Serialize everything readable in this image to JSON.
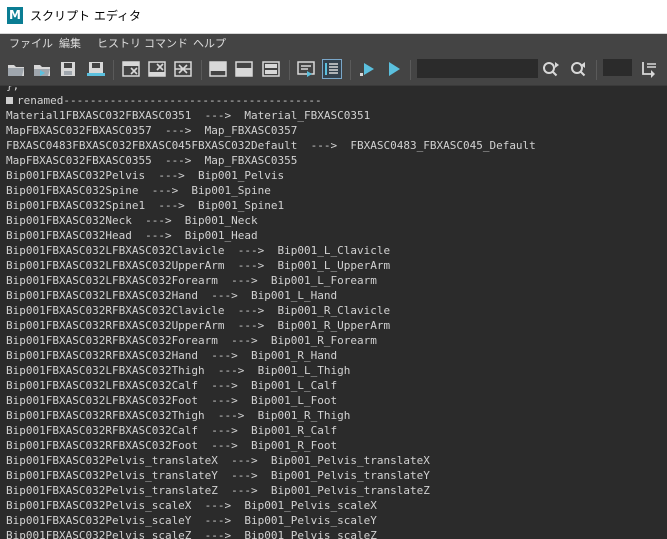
{
  "window": {
    "title": "スクリプト エディタ",
    "logo": "M"
  },
  "menu": [
    "ファイル",
    "編集",
    "ヒストリ",
    "コマンド",
    "ヘルプ"
  ],
  "toolbar": {
    "icons": [
      "open-script-icon",
      "source-script-icon",
      "save-script-icon",
      "save-to-shelf-icon",
      "clear-history-icon",
      "clear-input-icon",
      "clear-all-icon",
      "show-history-only-icon",
      "show-input-only-icon",
      "show-both-icon",
      "echo-all-commands-icon",
      "show-line-numbers-icon",
      "execute-selected-icon",
      "execute-all-icon",
      "search-next-icon",
      "search-previous-icon",
      "goto-line-icon"
    ],
    "search_value": "",
    "line_value": ""
  },
  "console": {
    "partial_line": "};",
    "header": "renamed---------------------------------------",
    "lines": [
      "Material1FBXASC032FBXASC0351  --->  Material_FBXASC0351",
      "MapFBXASC032FBXASC0357  --->  Map_FBXASC0357",
      "FBXASC0483FBXASC032FBXASC045FBXASC032Default  --->  FBXASC0483_FBXASC045_Default",
      "MapFBXASC032FBXASC0355  --->  Map_FBXASC0355",
      "Bip001FBXASC032Pelvis  --->  Bip001_Pelvis",
      "Bip001FBXASC032Spine  --->  Bip001_Spine",
      "Bip001FBXASC032Spine1  --->  Bip001_Spine1",
      "Bip001FBXASC032Neck  --->  Bip001_Neck",
      "Bip001FBXASC032Head  --->  Bip001_Head",
      "Bip001FBXASC032LFBXASC032Clavicle  --->  Bip001_L_Clavicle",
      "Bip001FBXASC032LFBXASC032UpperArm  --->  Bip001_L_UpperArm",
      "Bip001FBXASC032LFBXASC032Forearm  --->  Bip001_L_Forearm",
      "Bip001FBXASC032LFBXASC032Hand  --->  Bip001_L_Hand",
      "Bip001FBXASC032RFBXASC032Clavicle  --->  Bip001_R_Clavicle",
      "Bip001FBXASC032RFBXASC032UpperArm  --->  Bip001_R_UpperArm",
      "Bip001FBXASC032RFBXASC032Forearm  --->  Bip001_R_Forearm",
      "Bip001FBXASC032RFBXASC032Hand  --->  Bip001_R_Hand",
      "Bip001FBXASC032LFBXASC032Thigh  --->  Bip001_L_Thigh",
      "Bip001FBXASC032LFBXASC032Calf  --->  Bip001_L_Calf",
      "Bip001FBXASC032LFBXASC032Foot  --->  Bip001_L_Foot",
      "Bip001FBXASC032RFBXASC032Thigh  --->  Bip001_R_Thigh",
      "Bip001FBXASC032RFBXASC032Calf  --->  Bip001_R_Calf",
      "Bip001FBXASC032RFBXASC032Foot  --->  Bip001_R_Foot",
      "Bip001FBXASC032Pelvis_translateX  --->  Bip001_Pelvis_translateX",
      "Bip001FBXASC032Pelvis_translateY  --->  Bip001_Pelvis_translateY",
      "Bip001FBXASC032Pelvis_translateZ  --->  Bip001_Pelvis_translateZ",
      "Bip001FBXASC032Pelvis_scaleX  --->  Bip001_Pelvis_scaleX",
      "Bip001FBXASC032Pelvis_scaleY  --->  Bip001_Pelvis_scaleY",
      "Bip001FBXASC032Pelvis_scaleZ  --->  Bip001_Pelvis_scaleZ"
    ]
  },
  "colors": {
    "accent": "#5bc0de",
    "console_bg": "#2b2b2b",
    "panel_bg": "#444444",
    "text": "#d2d2d2"
  }
}
